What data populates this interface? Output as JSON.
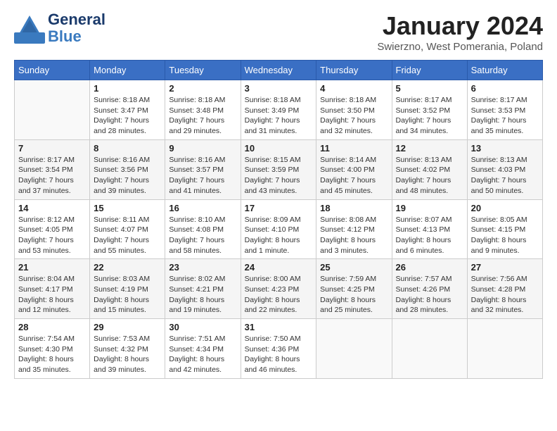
{
  "header": {
    "logo_line1": "General",
    "logo_line2": "Blue",
    "title": "January 2024",
    "location": "Swierzno, West Pomerania, Poland"
  },
  "weekdays": [
    "Sunday",
    "Monday",
    "Tuesday",
    "Wednesday",
    "Thursday",
    "Friday",
    "Saturday"
  ],
  "weeks": [
    [
      {
        "num": "",
        "info": ""
      },
      {
        "num": "1",
        "info": "Sunrise: 8:18 AM\nSunset: 3:47 PM\nDaylight: 7 hours\nand 28 minutes."
      },
      {
        "num": "2",
        "info": "Sunrise: 8:18 AM\nSunset: 3:48 PM\nDaylight: 7 hours\nand 29 minutes."
      },
      {
        "num": "3",
        "info": "Sunrise: 8:18 AM\nSunset: 3:49 PM\nDaylight: 7 hours\nand 31 minutes."
      },
      {
        "num": "4",
        "info": "Sunrise: 8:18 AM\nSunset: 3:50 PM\nDaylight: 7 hours\nand 32 minutes."
      },
      {
        "num": "5",
        "info": "Sunrise: 8:17 AM\nSunset: 3:52 PM\nDaylight: 7 hours\nand 34 minutes."
      },
      {
        "num": "6",
        "info": "Sunrise: 8:17 AM\nSunset: 3:53 PM\nDaylight: 7 hours\nand 35 minutes."
      }
    ],
    [
      {
        "num": "7",
        "info": "Sunrise: 8:17 AM\nSunset: 3:54 PM\nDaylight: 7 hours\nand 37 minutes."
      },
      {
        "num": "8",
        "info": "Sunrise: 8:16 AM\nSunset: 3:56 PM\nDaylight: 7 hours\nand 39 minutes."
      },
      {
        "num": "9",
        "info": "Sunrise: 8:16 AM\nSunset: 3:57 PM\nDaylight: 7 hours\nand 41 minutes."
      },
      {
        "num": "10",
        "info": "Sunrise: 8:15 AM\nSunset: 3:59 PM\nDaylight: 7 hours\nand 43 minutes."
      },
      {
        "num": "11",
        "info": "Sunrise: 8:14 AM\nSunset: 4:00 PM\nDaylight: 7 hours\nand 45 minutes."
      },
      {
        "num": "12",
        "info": "Sunrise: 8:13 AM\nSunset: 4:02 PM\nDaylight: 7 hours\nand 48 minutes."
      },
      {
        "num": "13",
        "info": "Sunrise: 8:13 AM\nSunset: 4:03 PM\nDaylight: 7 hours\nand 50 minutes."
      }
    ],
    [
      {
        "num": "14",
        "info": "Sunrise: 8:12 AM\nSunset: 4:05 PM\nDaylight: 7 hours\nand 53 minutes."
      },
      {
        "num": "15",
        "info": "Sunrise: 8:11 AM\nSunset: 4:07 PM\nDaylight: 7 hours\nand 55 minutes."
      },
      {
        "num": "16",
        "info": "Sunrise: 8:10 AM\nSunset: 4:08 PM\nDaylight: 7 hours\nand 58 minutes."
      },
      {
        "num": "17",
        "info": "Sunrise: 8:09 AM\nSunset: 4:10 PM\nDaylight: 8 hours\nand 1 minute."
      },
      {
        "num": "18",
        "info": "Sunrise: 8:08 AM\nSunset: 4:12 PM\nDaylight: 8 hours\nand 3 minutes."
      },
      {
        "num": "19",
        "info": "Sunrise: 8:07 AM\nSunset: 4:13 PM\nDaylight: 8 hours\nand 6 minutes."
      },
      {
        "num": "20",
        "info": "Sunrise: 8:05 AM\nSunset: 4:15 PM\nDaylight: 8 hours\nand 9 minutes."
      }
    ],
    [
      {
        "num": "21",
        "info": "Sunrise: 8:04 AM\nSunset: 4:17 PM\nDaylight: 8 hours\nand 12 minutes."
      },
      {
        "num": "22",
        "info": "Sunrise: 8:03 AM\nSunset: 4:19 PM\nDaylight: 8 hours\nand 15 minutes."
      },
      {
        "num": "23",
        "info": "Sunrise: 8:02 AM\nSunset: 4:21 PM\nDaylight: 8 hours\nand 19 minutes."
      },
      {
        "num": "24",
        "info": "Sunrise: 8:00 AM\nSunset: 4:23 PM\nDaylight: 8 hours\nand 22 minutes."
      },
      {
        "num": "25",
        "info": "Sunrise: 7:59 AM\nSunset: 4:25 PM\nDaylight: 8 hours\nand 25 minutes."
      },
      {
        "num": "26",
        "info": "Sunrise: 7:57 AM\nSunset: 4:26 PM\nDaylight: 8 hours\nand 28 minutes."
      },
      {
        "num": "27",
        "info": "Sunrise: 7:56 AM\nSunset: 4:28 PM\nDaylight: 8 hours\nand 32 minutes."
      }
    ],
    [
      {
        "num": "28",
        "info": "Sunrise: 7:54 AM\nSunset: 4:30 PM\nDaylight: 8 hours\nand 35 minutes."
      },
      {
        "num": "29",
        "info": "Sunrise: 7:53 AM\nSunset: 4:32 PM\nDaylight: 8 hours\nand 39 minutes."
      },
      {
        "num": "30",
        "info": "Sunrise: 7:51 AM\nSunset: 4:34 PM\nDaylight: 8 hours\nand 42 minutes."
      },
      {
        "num": "31",
        "info": "Sunrise: 7:50 AM\nSunset: 4:36 PM\nDaylight: 8 hours\nand 46 minutes."
      },
      {
        "num": "",
        "info": ""
      },
      {
        "num": "",
        "info": ""
      },
      {
        "num": "",
        "info": ""
      }
    ]
  ]
}
